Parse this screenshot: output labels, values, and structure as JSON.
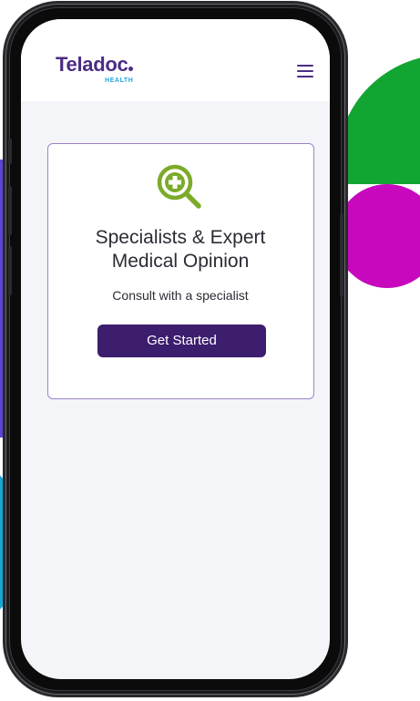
{
  "brand": {
    "name": "Teladoc",
    "subtitle": "HEALTH",
    "primary_color": "#4b2d83",
    "accent_color": "#1fa6df"
  },
  "header": {
    "menu_icon": "hamburger-menu-icon"
  },
  "card": {
    "icon": "magnifier-plus-icon",
    "icon_color": "#7cab2a",
    "title": "Specialists & Expert\nMedical Opinion",
    "subtitle": "Consult with a specialist",
    "cta_label": "Get Started",
    "cta_color": "#3c1d6e"
  },
  "decor": {
    "colors": [
      "#13a532",
      "#c708bd",
      "#5a45d6",
      "#16a7d6"
    ]
  }
}
